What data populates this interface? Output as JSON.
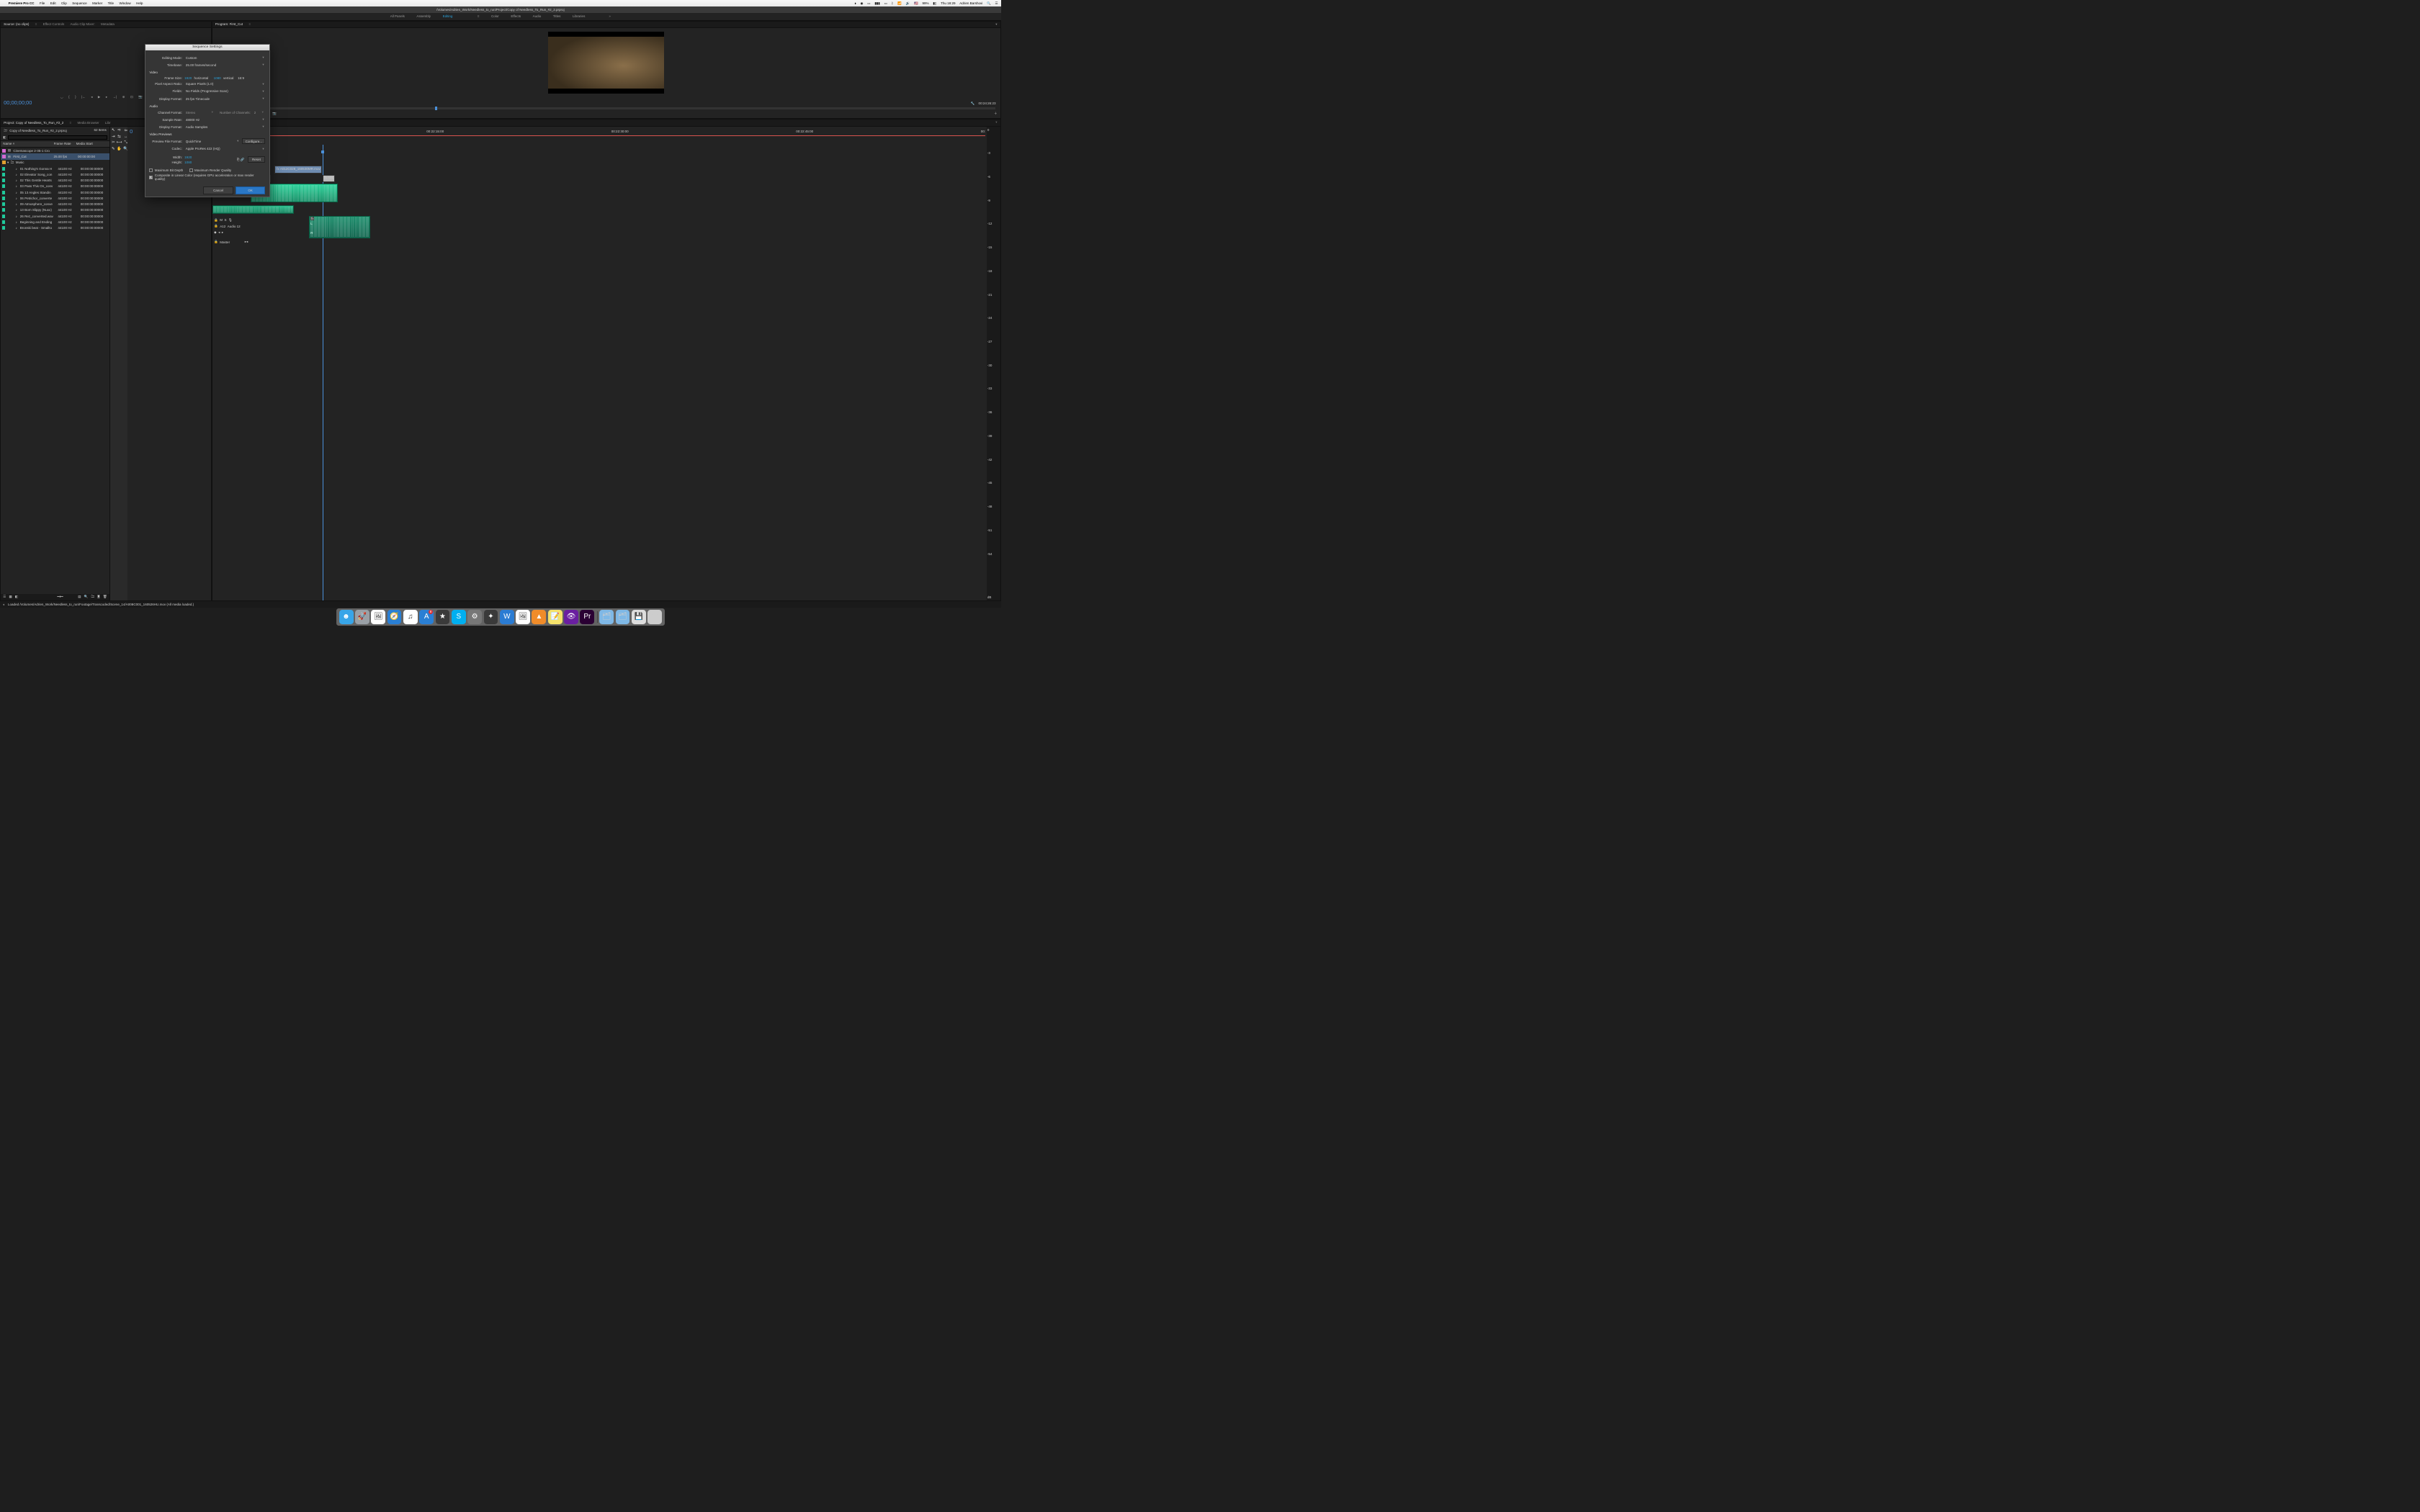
{
  "menubar": {
    "app_name": "Premiere Pro CC",
    "items": [
      "File",
      "Edit",
      "Clip",
      "Sequence",
      "Marker",
      "Title",
      "Window",
      "Help"
    ],
    "right": {
      "battery": "99%",
      "time": "Thu 18:29",
      "user": "Adrien Barshovi",
      "flag": "🇺🇸"
    }
  },
  "title_path": "/Volumes/Adrien_Work/Needless_to_run/Project/Copy of Needless_To_Run_#2_2.prproj",
  "workspaces": [
    "All Panels",
    "Assembly",
    "Editing",
    "Color",
    "Effects",
    "Audio",
    "Titles",
    "Libraries"
  ],
  "active_workspace": "Editing",
  "source": {
    "tabs": [
      "Source: (no clips)",
      "Effect Controls",
      "Audio Clip Mixer:",
      "Metadata"
    ],
    "timecode": "00;00;00;00"
  },
  "program": {
    "title": "Program: First_Cut",
    "fit": "Full",
    "timecode": "00:24:26:23"
  },
  "project": {
    "tabs": [
      "Project: Copy of Needless_To_Run_#2_2",
      "Media Browser",
      "Libr"
    ],
    "filename": "Copy of Needless_To_Run_#2_2.prproj",
    "item_count": "62 Items",
    "columns": [
      "Name",
      "Frame Rate",
      "Media Start"
    ],
    "rows": [
      {
        "swatch": "#d46ad4",
        "icon": "▤",
        "name": "Cinemascope 2-35-1 Cro",
        "fr": "",
        "ms": "",
        "indent": 1
      },
      {
        "swatch": "#d46ad4",
        "icon": "⊞",
        "name": "First_Cut",
        "fr": "25.00 fps",
        "ms": "00:00:00:00",
        "indent": 1,
        "sel": true
      },
      {
        "swatch": "#e0a030",
        "icon": "▸",
        "name": "Music",
        "fr": "",
        "ms": "",
        "indent": 1,
        "folder": true
      },
      {
        "swatch": "#1fc99b",
        "icon": "♪",
        "name": "01 Nothing's Gonna H",
        "fr": "44100 Hz",
        "ms": "00:00:00:00000",
        "indent": 2
      },
      {
        "swatch": "#1fc99b",
        "icon": "♪",
        "name": "02 Elevator Song_con",
        "fr": "44100 Hz",
        "ms": "00:00:00:00000",
        "indent": 2
      },
      {
        "swatch": "#1fc99b",
        "icon": "♪",
        "name": "02 This Gentle Hearts",
        "fr": "44100 Hz",
        "ms": "00:00:00:00000",
        "indent": 2
      },
      {
        "swatch": "#1fc99b",
        "icon": "♪",
        "name": "03 Pass This On_conv",
        "fr": "44100 Hz",
        "ms": "00:00:00:00000",
        "indent": 2
      },
      {
        "swatch": "#1fc99b",
        "icon": "♪",
        "name": "05 13 Angles Standin",
        "fr": "44100 Hz",
        "ms": "00:00:00:00000",
        "indent": 2
      },
      {
        "swatch": "#1fc99b",
        "icon": "♪",
        "name": "06 Petrichor_converte",
        "fr": "44100 Hz",
        "ms": "00:00:00:00000",
        "indent": 2
      },
      {
        "swatch": "#1fc99b",
        "icon": "♪",
        "name": "09 Atmosphere_conve",
        "fr": "44100 Hz",
        "ms": "00:00:00:00000",
        "indent": 2
      },
      {
        "swatch": "#1fc99b",
        "icon": "♪",
        "name": "13 Born Slippy (Nuxx)",
        "fr": "44100 Hz",
        "ms": "00:00:00:00000",
        "indent": 2
      },
      {
        "swatch": "#1fc99b",
        "icon": "♪",
        "name": "26 Rez_converted.wav",
        "fr": "44100 Hz",
        "ms": "00:00:00:00000",
        "indent": 2
      },
      {
        "swatch": "#1fc99b",
        "icon": "♪",
        "name": "Beginning and Ending",
        "fr": "44100 Hz",
        "ms": "00:00:00:00000",
        "indent": 2
      },
      {
        "swatch": "#1fc99b",
        "icon": "♪",
        "name": "Bronski beat - Smallto",
        "fr": "44100 Hz",
        "ms": "00:00:00:00000",
        "indent": 2
      }
    ]
  },
  "timeline": {
    "ruler": [
      "00:00",
      "00:22:15:00",
      "00:22:30:00",
      "00:22:45:00",
      "00:"
    ],
    "clip1": "A012C028_160530MR.mov [V",
    "clip2": "A01",
    "track_label": "A12",
    "track_name": "Audio 12",
    "master": "Master"
  },
  "meters": [
    "0",
    "-3",
    "-6",
    "-9",
    "-12",
    "-15",
    "-18",
    "-21",
    "-24",
    "-27",
    "-30",
    "-33",
    "-36",
    "-39",
    "-42",
    "-45",
    "-48",
    "-51",
    "-54",
    "",
    "dB"
  ],
  "dialog": {
    "title": "Sequence Settings",
    "editing_mode_label": "Editing Mode:",
    "editing_mode": "Custom",
    "timebase_label": "Timebase:",
    "timebase": "25.00  frames/second",
    "video": "Video",
    "frame_size_label": "Frame Size:",
    "width": "1920",
    "h_label": "horizontal",
    "height_v": "1080",
    "v_label": "vertical",
    "aspect": "16:9",
    "par_label": "Pixel Aspect Ratio:",
    "par": "Square Pixels (1.0)",
    "fields_label": "Fields:",
    "fields": "No Fields (Progressive Scan)",
    "disp_label": "Display Format:",
    "disp": "25 fps Timecode",
    "audio": "Audio",
    "chfmt_label": "Channel Format:",
    "chfmt": "Stereo",
    "numch_label": "Number of Channels:",
    "numch": "2",
    "srate_label": "Sample Rate:",
    "srate": "48000 Hz",
    "adisp_label": "Display Format:",
    "adisp": "Audio Samples",
    "vprev": "Video Previews",
    "pff_label": "Preview File Format:",
    "pff": "QuickTime",
    "configure": "Configure...",
    "codec_label": "Codec:",
    "codec": "Apple ProRes 422 (HQ)",
    "w_label": "Width:",
    "w": "1920",
    "h2_label": "Height:",
    "h2": "1080",
    "reset": "Reset",
    "maxbit": "Maximum Bit Depth",
    "maxrq": "Maximum Render Quality",
    "composite": "Composite in Linear Color (requires GPU acceleration or max render quality)",
    "cancel": "Cancel",
    "ok": "OK"
  },
  "status": "Loaded /Volumes/Adrien_Work/Needless_to_run/Footage/Transcoded/Scene_14/A008C001_160526HU.mov (All media loaded.)",
  "dock": [
    {
      "name": "finder",
      "bg": "#38a5e8",
      "glyph": "☻"
    },
    {
      "name": "launchpad",
      "bg": "#9aa0a6",
      "glyph": "🚀"
    },
    {
      "name": "photos",
      "bg": "#fff",
      "glyph": "🖼"
    },
    {
      "name": "safari",
      "bg": "#2a7fd4",
      "glyph": "🧭"
    },
    {
      "name": "itunes",
      "bg": "#fff",
      "glyph": "♫"
    },
    {
      "name": "appstore",
      "bg": "#2a7fd4",
      "glyph": "A",
      "badge": "8"
    },
    {
      "name": "imovie",
      "bg": "#3a3a3a",
      "glyph": "★"
    },
    {
      "name": "skype",
      "bg": "#00aff0",
      "glyph": "S"
    },
    {
      "name": "settings",
      "bg": "#777",
      "glyph": "⚙"
    },
    {
      "name": "fcp",
      "bg": "#3a3a3a",
      "glyph": "✦"
    },
    {
      "name": "word",
      "bg": "#2b7cd3",
      "glyph": "W"
    },
    {
      "name": "preview",
      "bg": "#fff",
      "glyph": "🖼"
    },
    {
      "name": "vlc",
      "bg": "#f08c2a",
      "glyph": "▲"
    },
    {
      "name": "notes",
      "bg": "#f5e26b",
      "glyph": "📝"
    },
    {
      "name": "eye",
      "bg": "#6a1fa0",
      "glyph": "👁"
    },
    {
      "name": "premiere",
      "bg": "#2a0033",
      "glyph": "Pr"
    }
  ]
}
